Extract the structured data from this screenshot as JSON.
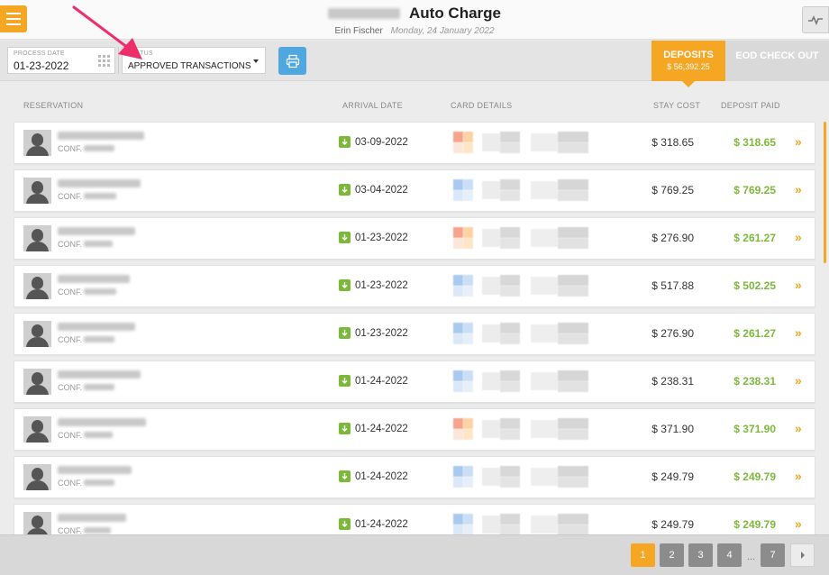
{
  "header": {
    "title": "Auto Charge",
    "user": "Erin Fischer",
    "date": "Monday, 24 January 2022"
  },
  "toolbar": {
    "process_date_label": "PROCESS DATE",
    "process_date_value": "01-23-2022",
    "status_label": "STATUS",
    "status_value": "APPROVED TRANSACTIONS",
    "deposits_label": "DEPOSITS",
    "deposits_amount": "$ 56,392.25",
    "eod_label": "EOD CHECK OUT"
  },
  "columns": {
    "reservation": "RESERVATION",
    "arrival": "ARRIVAL DATE",
    "card": "CARD DETAILS",
    "stay": "STAY COST",
    "deposit": "DEPOSIT PAID"
  },
  "rows": [
    {
      "conf_label": "CONF.",
      "arrival": "03-09-2022",
      "stay_cost": "$ 318.65",
      "deposit_paid": "$ 318.65",
      "card": "red"
    },
    {
      "conf_label": "CONF.",
      "arrival": "03-04-2022",
      "stay_cost": "$ 769.25",
      "deposit_paid": "$ 769.25",
      "card": "blue"
    },
    {
      "conf_label": "CONF.",
      "arrival": "01-23-2022",
      "stay_cost": "$ 276.90",
      "deposit_paid": "$ 261.27",
      "card": "red"
    },
    {
      "conf_label": "CONF.",
      "arrival": "01-23-2022",
      "stay_cost": "$ 517.88",
      "deposit_paid": "$ 502.25",
      "card": "blue"
    },
    {
      "conf_label": "CONF.",
      "arrival": "01-23-2022",
      "stay_cost": "$ 276.90",
      "deposit_paid": "$ 261.27",
      "card": "blue"
    },
    {
      "conf_label": "CONF.",
      "arrival": "01-24-2022",
      "stay_cost": "$ 238.31",
      "deposit_paid": "$ 238.31",
      "card": "blue"
    },
    {
      "conf_label": "CONF.",
      "arrival": "01-24-2022",
      "stay_cost": "$ 371.90",
      "deposit_paid": "$ 371.90",
      "card": "red"
    },
    {
      "conf_label": "CONF.",
      "arrival": "01-24-2022",
      "stay_cost": "$ 249.79",
      "deposit_paid": "$ 249.79",
      "card": "blue"
    },
    {
      "conf_label": "CONF.",
      "arrival": "01-24-2022",
      "stay_cost": "$ 249.79",
      "deposit_paid": "$ 249.79",
      "card": "blue"
    }
  ],
  "pagination": {
    "pages": [
      "1",
      "2",
      "3",
      "4"
    ],
    "ellipsis": "...",
    "last": "7",
    "active": "1"
  },
  "colors": {
    "accent": "#f5a623",
    "paid_green": "#7cb83a",
    "print_blue": "#4fa7e0",
    "annotation": "#ee2e6b"
  },
  "icons": {
    "menu": "hamburger-icon",
    "activity": "activity-icon",
    "calendar": "calendar-grid-icon",
    "print": "printer-icon",
    "arrival": "arrow-down-icon",
    "row_action": "double-chevron-right-icon"
  }
}
